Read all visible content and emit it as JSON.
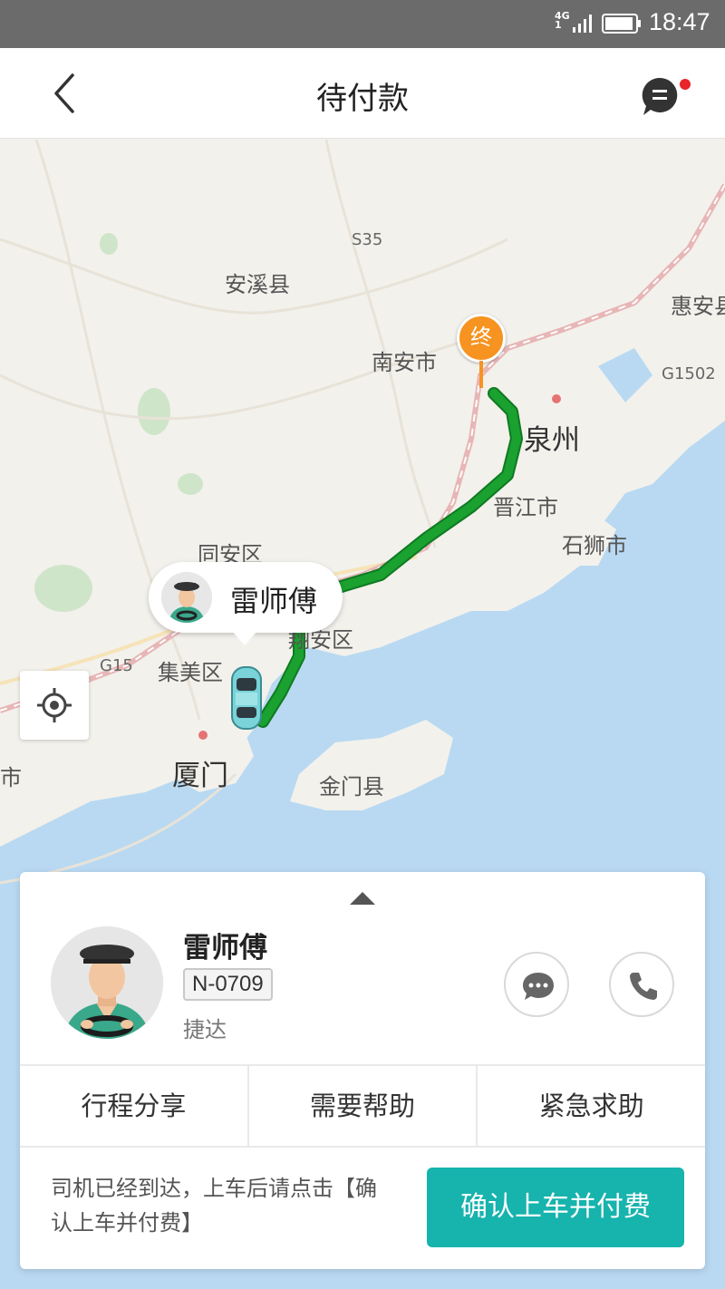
{
  "status_bar": {
    "network": "4G",
    "network_sub": "1",
    "time": "18:47"
  },
  "header": {
    "title": "待付款",
    "back_icon": "chevron-left-icon",
    "message_icon": "message-icon",
    "has_unread": true
  },
  "map": {
    "labels": {
      "s35": "S35",
      "anxi": "安溪县",
      "nanan": "南安市",
      "huian": "惠安县",
      "g1502": "G1502",
      "quanzhou": "泉州",
      "jinjiang": "晋江市",
      "shishi": "石狮市",
      "tongan": "同安区",
      "xiangan": "翔安区",
      "g15": "G15",
      "jimei": "集美区",
      "xiamen": "厦门",
      "jinmen": "金门县",
      "shi": "市"
    },
    "end_marker": "终",
    "driver_bubble_name": "雷师傅"
  },
  "driver": {
    "name": "雷师傅",
    "plate": "N-0709",
    "car_model": "捷达"
  },
  "actions": {
    "share": "行程分享",
    "help": "需要帮助",
    "sos": "紧急求助"
  },
  "footer": {
    "notice": "司机已经到达，上车后请点击【确认上车并付费】",
    "confirm_button": "确认上车并付费"
  },
  "colors": {
    "accent": "#17b3ad",
    "route": "#1aa130",
    "end_pin": "#f79320",
    "water": "#b9d9f2"
  }
}
